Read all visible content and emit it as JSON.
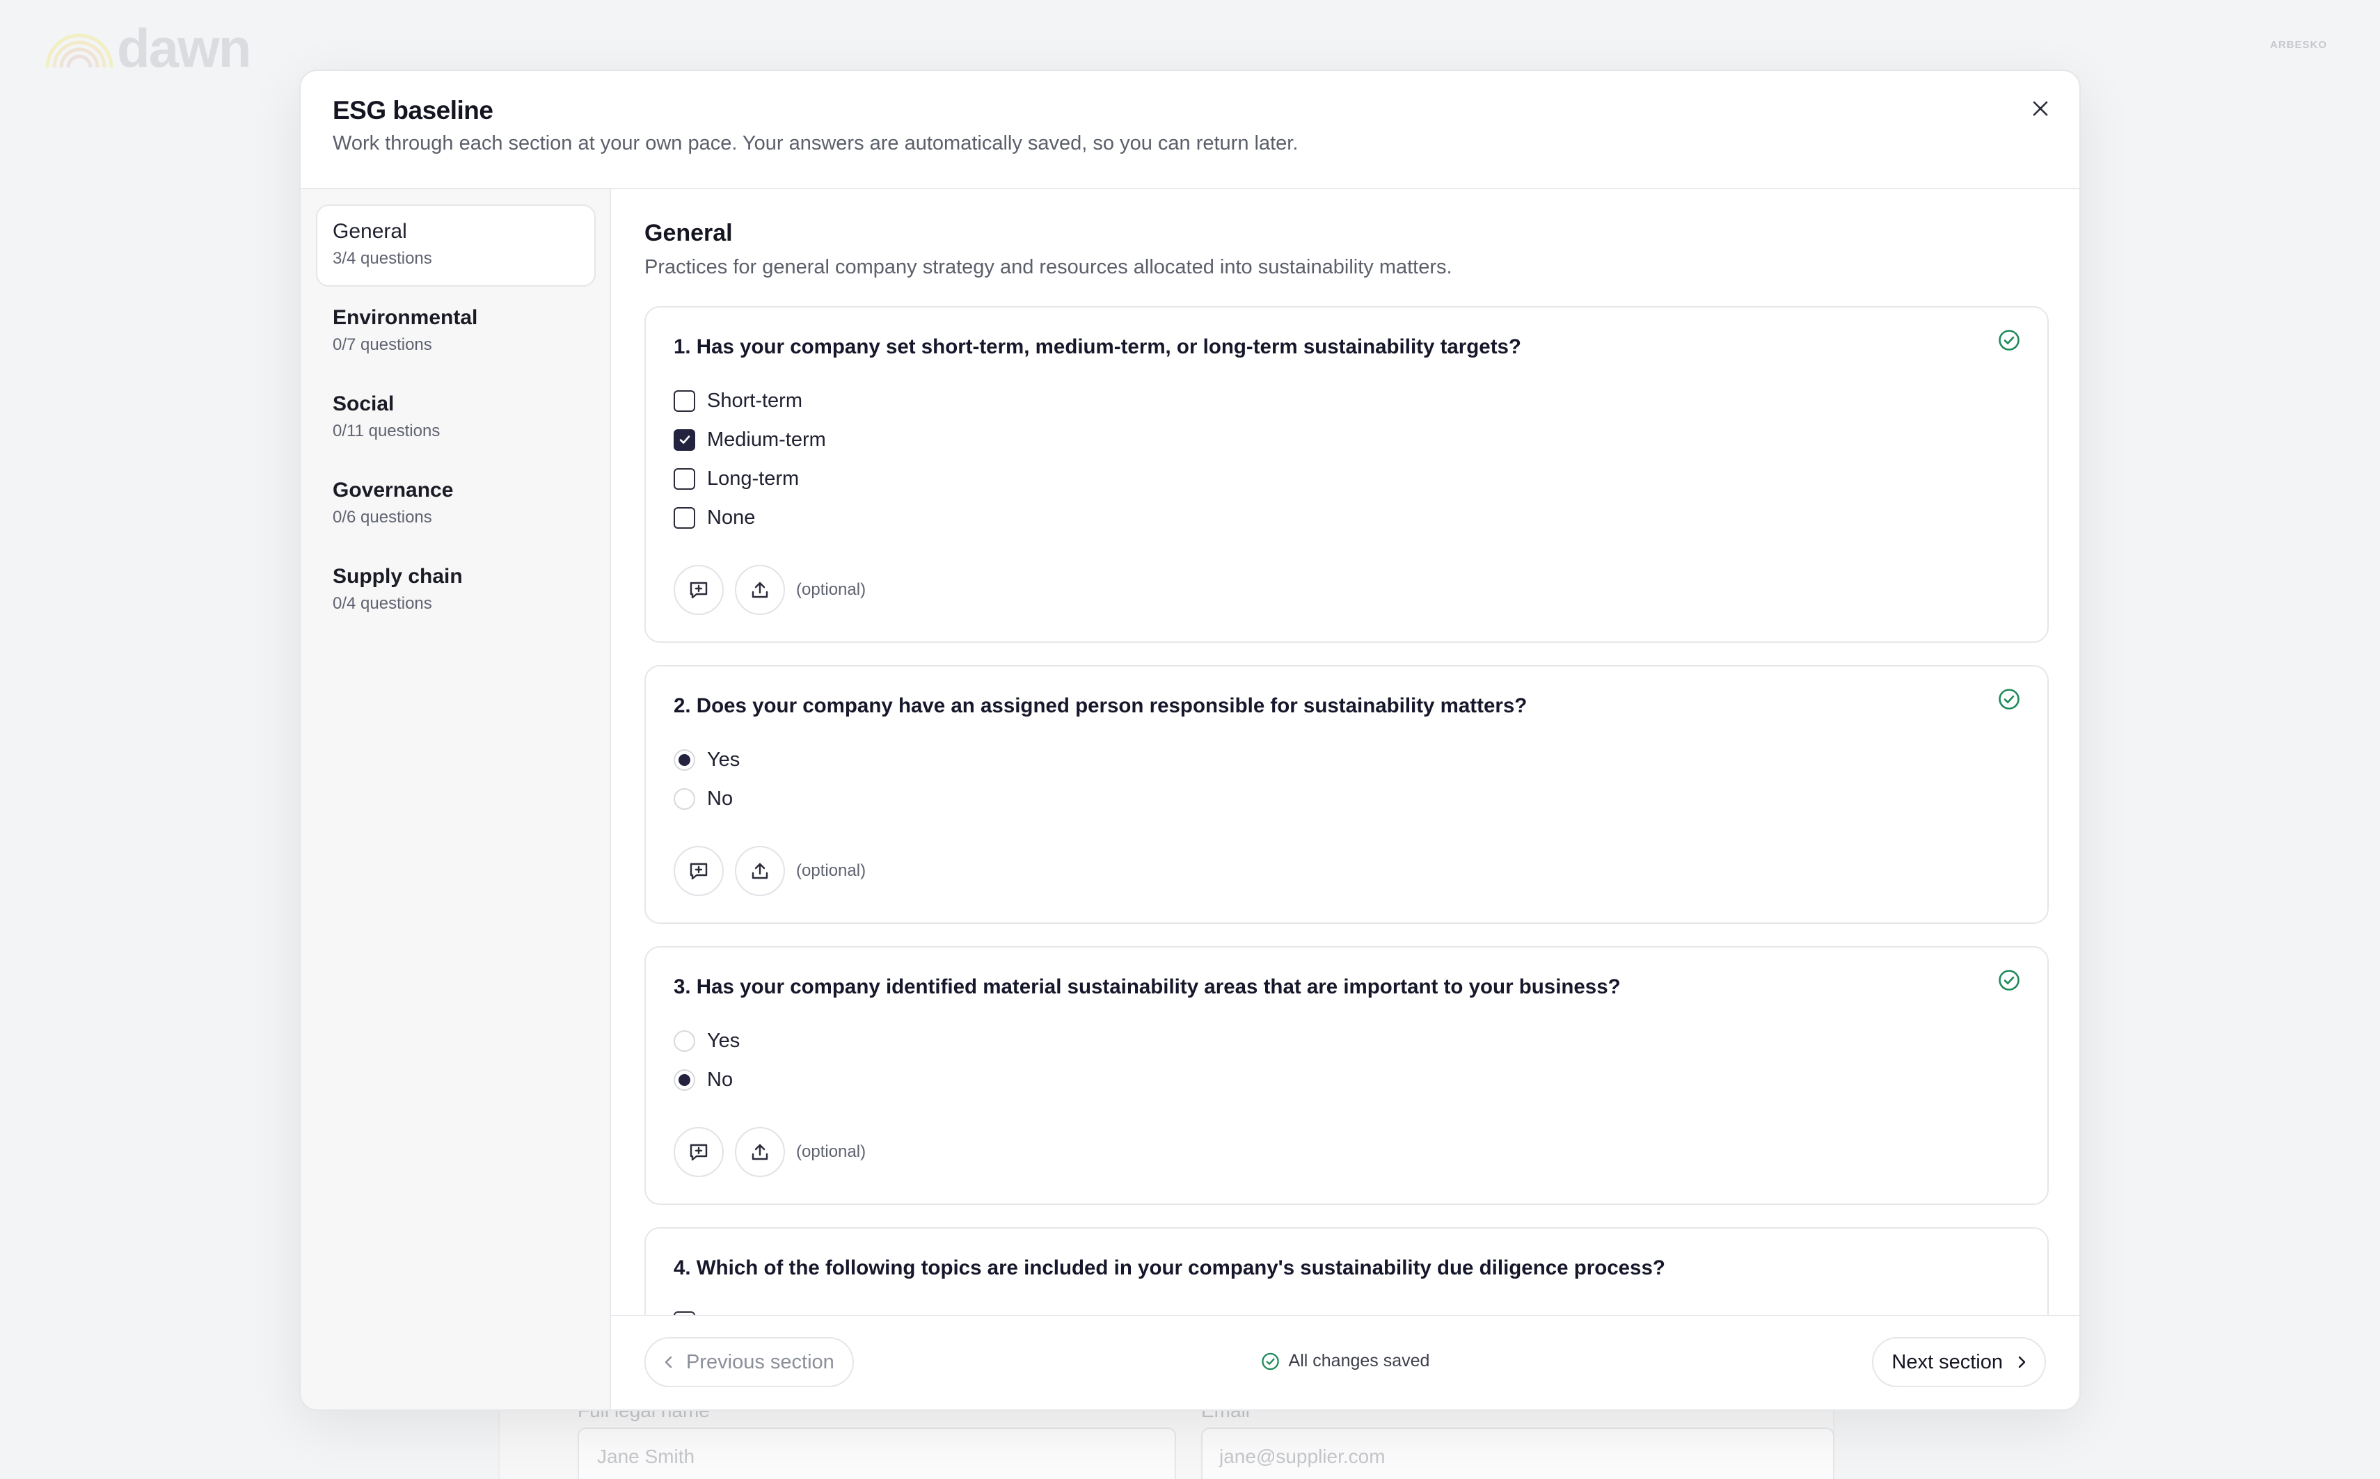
{
  "background": {
    "logo_text": "dawn",
    "brand_text": "ARBESKO",
    "fields": [
      {
        "label": "Full legal name",
        "placeholder": "Jane Smith"
      },
      {
        "label": "Email",
        "placeholder": "jane@supplier.com"
      }
    ]
  },
  "modal": {
    "title": "ESG baseline",
    "subtitle": "Work through each section at your own pace. Your answers are automatically saved, so you can return later.",
    "close_icon": "close-icon"
  },
  "sidebar": {
    "items": [
      {
        "name": "General",
        "count": "3/4 questions",
        "active": true
      },
      {
        "name": "Environmental",
        "count": "0/7 questions"
      },
      {
        "name": "Social",
        "count": "0/11 questions"
      },
      {
        "name": "Governance",
        "count": "0/6 questions"
      },
      {
        "name": "Supply chain",
        "count": "0/4 questions"
      }
    ]
  },
  "section": {
    "title": "General",
    "description": "Practices for general company strategy and resources allocated into sustainability matters."
  },
  "questions": [
    {
      "text": "1. Has your company set short-term, medium-term, or long-term sustainability targets?",
      "answered": true,
      "type": "checkbox",
      "options": [
        {
          "label": "Short-term",
          "checked": false
        },
        {
          "label": "Medium-term",
          "checked": true
        },
        {
          "label": "Long-term",
          "checked": false
        },
        {
          "label": "None",
          "checked": false
        }
      ],
      "optional_label": "(optional)"
    },
    {
      "text": "2. Does your company have an assigned person responsible for sustainability matters?",
      "answered": true,
      "type": "radio",
      "options": [
        {
          "label": "Yes",
          "checked": true
        },
        {
          "label": "No",
          "checked": false
        }
      ],
      "optional_label": "(optional)"
    },
    {
      "text": "3. Has your company identified material sustainability areas that are important to your business?",
      "answered": true,
      "type": "radio",
      "options": [
        {
          "label": "Yes",
          "checked": false
        },
        {
          "label": "No",
          "checked": true
        }
      ],
      "optional_label": "(optional)"
    },
    {
      "text": "4. Which of the following topics are included in your company's sustainability due diligence process?",
      "answered": false,
      "type": "checkbox"
    }
  ],
  "footer": {
    "prev_label": "Previous section",
    "saved_label": "All changes saved",
    "next_label": "Next section"
  },
  "colors": {
    "accent": "#23233f",
    "success": "#1f8a5b",
    "muted_text": "#5b5f6a",
    "border": "#e4e6e9"
  }
}
